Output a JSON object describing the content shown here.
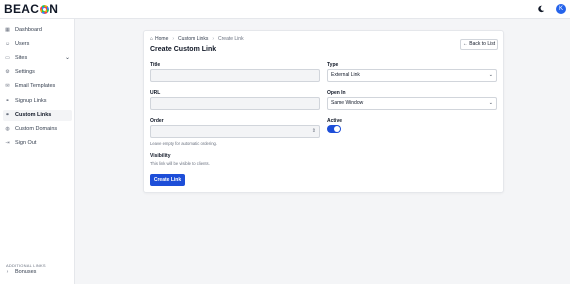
{
  "app": {
    "brand": "BEAC",
    "brand_tail": "N",
    "avatar_initial": "K"
  },
  "icons": {
    "theme": "moon-icon",
    "avatar": "user-avatar"
  },
  "sidebar": {
    "items": [
      {
        "label": "Dashboard",
        "icon": "grid-icon"
      },
      {
        "label": "Users",
        "icon": "users-icon"
      },
      {
        "label": "Sites",
        "icon": "sites-icon",
        "expandable": true
      },
      {
        "label": "Settings",
        "icon": "gear-icon"
      },
      {
        "label": "Email Templates",
        "icon": "mail-icon"
      },
      {
        "label": "Signup Links",
        "icon": "link-icon"
      },
      {
        "label": "Custom Links",
        "icon": "link-icon",
        "active": true
      },
      {
        "label": "Custom Domains",
        "icon": "globe-icon"
      },
      {
        "label": "Sign Out",
        "icon": "signout-icon"
      }
    ],
    "section_title": "ADDITIONAL LINKS",
    "extra_items": [
      {
        "label": "Bonuses",
        "icon": "chevron-right-icon"
      }
    ]
  },
  "breadcrumb": {
    "home": "Home",
    "parent": "Custom Links",
    "current": "Create Link"
  },
  "page": {
    "title": "Create Custom Link",
    "back_label": "Back to List"
  },
  "form": {
    "title": {
      "label": "Title",
      "value": ""
    },
    "type": {
      "label": "Type",
      "value": "External Link"
    },
    "url": {
      "label": "URL",
      "value": ""
    },
    "open_in": {
      "label": "Open In",
      "value": "Same Window"
    },
    "order": {
      "label": "Order",
      "value": "",
      "hint": "Leave empty for automatic ordering."
    },
    "active": {
      "label": "Active",
      "on": true
    },
    "visibility": {
      "label": "Visibility",
      "hint": "This link will be visible to clients."
    },
    "submit_label": "Create Link"
  },
  "colors": {
    "accent": "#1d4ed8",
    "background": "#f4f5f7"
  }
}
